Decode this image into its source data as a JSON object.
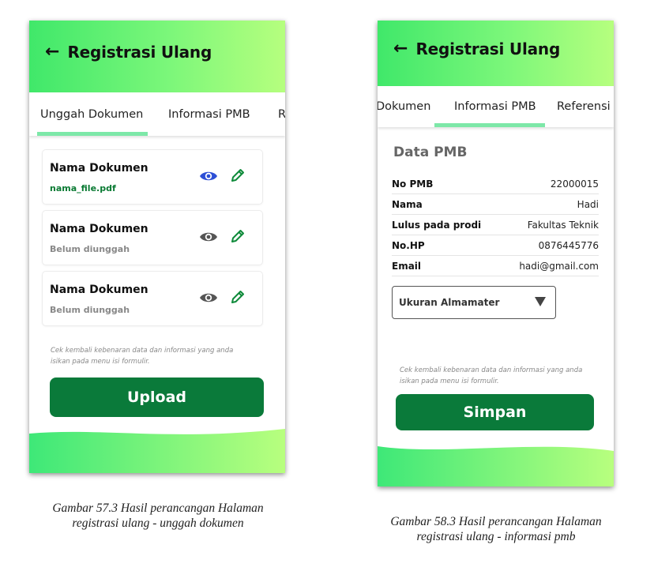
{
  "colors": {
    "accent_green": "#0a7a3a",
    "header_gradient_start": "#40e86a",
    "header_gradient_end": "#b6ff7e",
    "tab_indicator": "#7de8a8",
    "eye_active": "#2d4fd6",
    "pencil": "#0f8a3a"
  },
  "screen1": {
    "appbar": {
      "back_icon": "←",
      "title": "Registrasi Ulang"
    },
    "tabs": [
      "Unggah Dokumen",
      "Informasi PMB",
      "R"
    ],
    "documents": [
      {
        "title": "Nama Dokumen",
        "status": "nama_file.pdf",
        "uploaded": true
      },
      {
        "title": "Nama Dokumen",
        "status": "Belum diunggah",
        "uploaded": false
      },
      {
        "title": "Nama Dokumen",
        "status": "Belum diunggah",
        "uploaded": false
      }
    ],
    "note_line1": "Cek kembali kebenaran data dan informasi yang anda",
    "note_line2": "isikan pada menu isi formulir.",
    "upload_label": "Upload"
  },
  "screen2": {
    "appbar": {
      "back_icon": "←",
      "title": "Registrasi Ulang"
    },
    "tabs": [
      "Dokumen",
      "Informasi PMB",
      "Referensi PI"
    ],
    "section_title": "Data PMB",
    "fields": [
      {
        "label": "No PMB",
        "value": "22000015"
      },
      {
        "label": "Nama",
        "value": "Hadi"
      },
      {
        "label": "Lulus pada prodi",
        "value": "Fakultas Teknik"
      },
      {
        "label": "No.HP",
        "value": "0876445776"
      },
      {
        "label": "Email",
        "value": "hadi@gmail.com"
      }
    ],
    "dropdown_label": "Ukuran Almamater",
    "note_line1": "Cek kembali kebenaran data dan informasi yang anda",
    "note_line2": "isikan pada menu isi formulir.",
    "save_label": "Simpan"
  },
  "captions": {
    "left_line1": "Gambar 57.3 Hasil perancangan Halaman",
    "left_line2": "registrasi ulang - unggah dokumen",
    "right_line1": "Gambar 58.3 Hasil perancangan Halaman",
    "right_line2": "registrasi ulang - informasi pmb"
  }
}
